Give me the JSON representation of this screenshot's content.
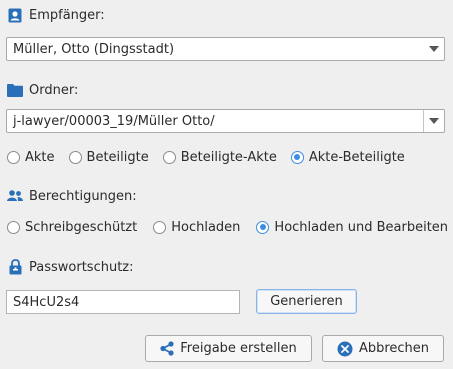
{
  "recipient": {
    "label": "Empfänger:",
    "icon": "contact-card-icon",
    "selected": "Müller, Otto (Dingsstadt)"
  },
  "folder": {
    "label": "Ordner:",
    "icon": "folder-icon",
    "path": "j-lawyer/00003_19/Müller Otto/",
    "options": [
      {
        "label": "Akte",
        "checked": false
      },
      {
        "label": "Beteiligte",
        "checked": false
      },
      {
        "label": "Beteiligte-Akte",
        "checked": false
      },
      {
        "label": "Akte-Beteiligte",
        "checked": true
      }
    ]
  },
  "permissions": {
    "label": "Berechtigungen:",
    "icon": "users-icon",
    "options": [
      {
        "label": "Schreibgeschützt",
        "checked": false
      },
      {
        "label": "Hochladen",
        "checked": false
      },
      {
        "label": "Hochladen und Bearbeiten",
        "checked": true
      }
    ]
  },
  "password": {
    "label": "Passwortschutz:",
    "icon": "lock-icon",
    "value": "S4HcU2s4",
    "generate_label": "Generieren"
  },
  "actions": {
    "share_label": "Freigabe erstellen",
    "cancel_label": "Abbrechen"
  },
  "colors": {
    "accent": "#3d8de0",
    "icon_blue": "#2a6fb8"
  }
}
